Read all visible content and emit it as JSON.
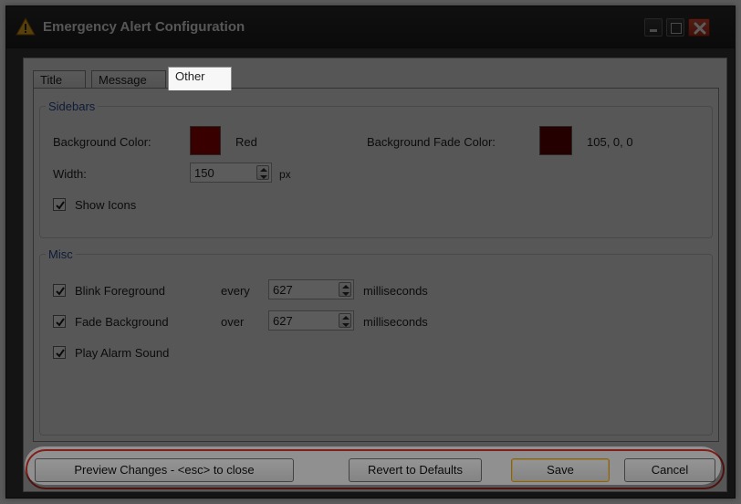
{
  "window": {
    "title": "Emergency Alert Configuration",
    "icon": "warning-triangle-icon",
    "controls": [
      "minimize-icon",
      "maximize-icon",
      "close-icon"
    ]
  },
  "tabs": [
    {
      "label": "Title",
      "active": false
    },
    {
      "label": "Message",
      "active": false
    },
    {
      "label": "Other",
      "active": true
    }
  ],
  "sidebars": {
    "legend": "Sidebars",
    "bg_color_label": "Background Color:",
    "bg_color_value": "Red",
    "bg_color_hex": "#a00000",
    "fade_color_label": "Background Fade Color:",
    "fade_color_value": "105, 0, 0",
    "fade_color_hex": "#690000",
    "width_label": "Width:",
    "width_value": "150",
    "width_unit": "px",
    "show_icons_label": "Show Icons",
    "show_icons_checked": true
  },
  "misc": {
    "legend": "Misc",
    "blink": {
      "label": "Blink Foreground",
      "checked": true,
      "connector": "every",
      "value": "627",
      "unit": "milliseconds"
    },
    "fade": {
      "label": "Fade Background",
      "checked": true,
      "connector": "over",
      "value": "627",
      "unit": "milliseconds"
    },
    "alarm": {
      "label": "Play Alarm Sound",
      "checked": true
    }
  },
  "buttons": {
    "preview": "Preview Changes - <esc> to close",
    "revert": "Revert to Defaults",
    "save": "Save",
    "cancel": "Cancel"
  },
  "colors": {
    "highlight_border": "#d9322a",
    "legend_text": "#2a4d9c",
    "default_button_border": "#e0a52a"
  }
}
